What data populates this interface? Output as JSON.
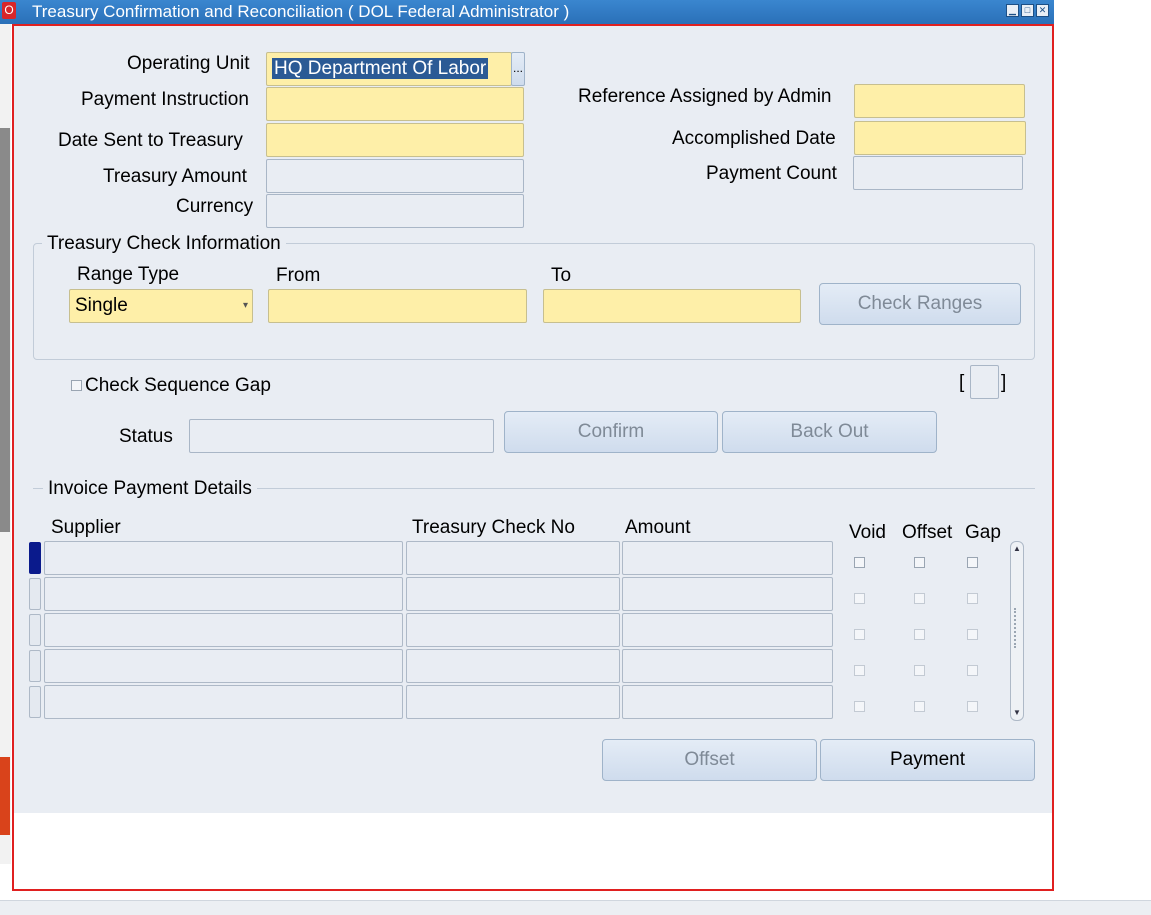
{
  "window": {
    "app_icon": "O",
    "title": "Treasury Confirmation and Reconciliation ( DOL Federal Administrator )",
    "controls": [
      "minimize-icon",
      "maximize-icon",
      "close-icon"
    ]
  },
  "header": {
    "operating_unit_label": "Operating Unit",
    "operating_unit_value": "HQ Department Of Labor",
    "lov_button": "...",
    "payment_instruction_label": "Payment Instruction",
    "payment_instruction_value": "",
    "date_sent_label": "Date Sent to Treasury",
    "date_sent_value": "",
    "treasury_amount_label": "Treasury Amount",
    "treasury_amount_value": "",
    "currency_label": "Currency",
    "currency_value": "",
    "reference_label": "Reference Assigned by Admin",
    "reference_value": "",
    "accomplished_date_label": "Accomplished Date",
    "accomplished_date_value": "",
    "payment_count_label": "Payment Count",
    "payment_count_value": ""
  },
  "check_info": {
    "title": "Treasury Check Information",
    "range_type_label": "Range Type",
    "range_type_value": "Single",
    "from_label": "From",
    "from_value": "",
    "to_label": "To",
    "to_value": "",
    "check_ranges_button": "Check Ranges"
  },
  "status_area": {
    "check_sequence_gap_label": "Check Sequence Gap",
    "check_sequence_gap_checked": false,
    "bracket_open": "[",
    "bracket_close": "]",
    "status_label": "Status",
    "status_value": "",
    "confirm_button": "Confirm",
    "back_out_button": "Back Out"
  },
  "details": {
    "title": "Invoice Payment Details",
    "columns": {
      "supplier": "Supplier",
      "check_no": "Treasury Check No",
      "amount": "Amount",
      "void": "Void",
      "offset": "Offset",
      "gap": "Gap"
    },
    "row_count": 5
  },
  "footer": {
    "offset_button": "Offset",
    "payment_button": "Payment"
  },
  "colors": {
    "title_bar": "#2a70b8",
    "required_field": "#feefa8",
    "form_background": "#e9edf3",
    "focus_frame": "#e02020"
  }
}
